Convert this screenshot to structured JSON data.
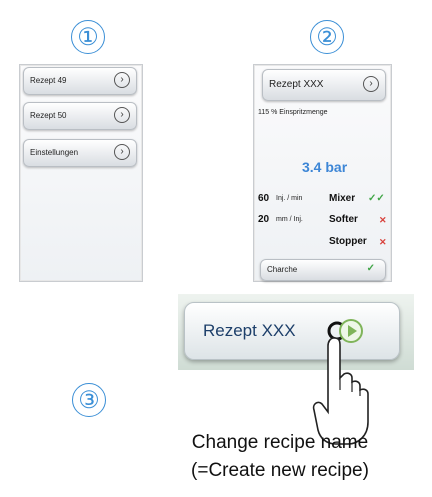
{
  "step_labels": [
    "①",
    "②",
    "③"
  ],
  "panel1": {
    "items": [
      {
        "label": "Rezept 49",
        "icon": "chevron-right-icon"
      },
      {
        "label": "Rezept 50",
        "icon": "chevron-right-icon"
      },
      {
        "label": "Einstellungen",
        "icon": "chevron-right-icon"
      }
    ]
  },
  "panel2": {
    "header": "Rezept XXX",
    "injection_amount": "115 % Einspritzmenge",
    "pressure": "3.4 bar",
    "rows": [
      {
        "value": "60",
        "unit": "Inj. / min",
        "name": "Mixer",
        "status": "✓✓"
      },
      {
        "value": "20",
        "unit": "mm / Inj.",
        "name": "Softer",
        "status": "✕"
      },
      {
        "value": "",
        "unit": "",
        "name": "Stopper",
        "status": "✕"
      }
    ],
    "bottom_button": "Charche",
    "bottom_status": "✓"
  },
  "zoom": {
    "label": "Rezept XXX",
    "icon": "play-button-icon"
  },
  "caption": {
    "line1": "Change recipe name",
    "line2": "(=Create new recipe)"
  },
  "colors": {
    "step_circle": "#3b8fd6",
    "ok": "#41a547",
    "bad": "#d8413b",
    "pressure": "#3d86d6"
  }
}
